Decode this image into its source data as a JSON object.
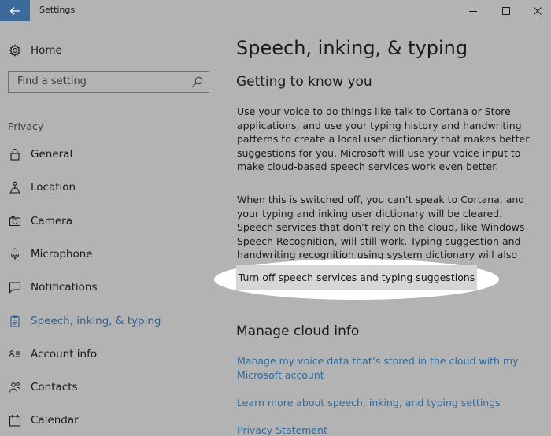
{
  "window": {
    "title": "Settings"
  },
  "sidebar": {
    "home_label": "Home",
    "search_placeholder": "Find a setting",
    "group_label": "Privacy",
    "items": [
      {
        "label": "General",
        "icon": "lock-icon"
      },
      {
        "label": "Location",
        "icon": "location-person-icon"
      },
      {
        "label": "Camera",
        "icon": "camera-icon"
      },
      {
        "label": "Microphone",
        "icon": "microphone-icon"
      },
      {
        "label": "Notifications",
        "icon": "notification-icon"
      },
      {
        "label": "Speech, inking, & typing",
        "icon": "clipboard-icon",
        "active": true
      },
      {
        "label": "Account info",
        "icon": "account-info-icon"
      },
      {
        "label": "Contacts",
        "icon": "contacts-icon"
      },
      {
        "label": "Calendar",
        "icon": "calendar-icon"
      }
    ]
  },
  "main": {
    "title": "Speech, inking, & typing",
    "section1_heading": "Getting to know you",
    "para1": "Use your voice to do things like talk to Cortana or Store applications, and use your typing history and handwriting patterns to create a local user dictionary that makes better suggestions for you. Microsoft will use your voice input to make cloud-based speech services work even better.",
    "para2": "When this is switched off, you can’t speak to Cortana, and your typing and inking user dictionary will be cleared. Speech services that don’t rely on the cloud, like Windows Speech Recognition, will still work. Typing suggestion and handwriting recognition using system dictionary will also continue to work.",
    "button_label": "Turn off speech services and typing suggestions",
    "section2_heading": "Manage cloud info",
    "links": [
      "Manage my voice data that’s stored in the cloud with my Microsoft account",
      "Learn more about speech, inking, and typing settings",
      "Privacy Statement"
    ]
  },
  "colors": {
    "accent": "#2f5f8f",
    "link": "#2e6a9e",
    "back_button": "#3a6a9a",
    "background": "#b3b3b3"
  }
}
